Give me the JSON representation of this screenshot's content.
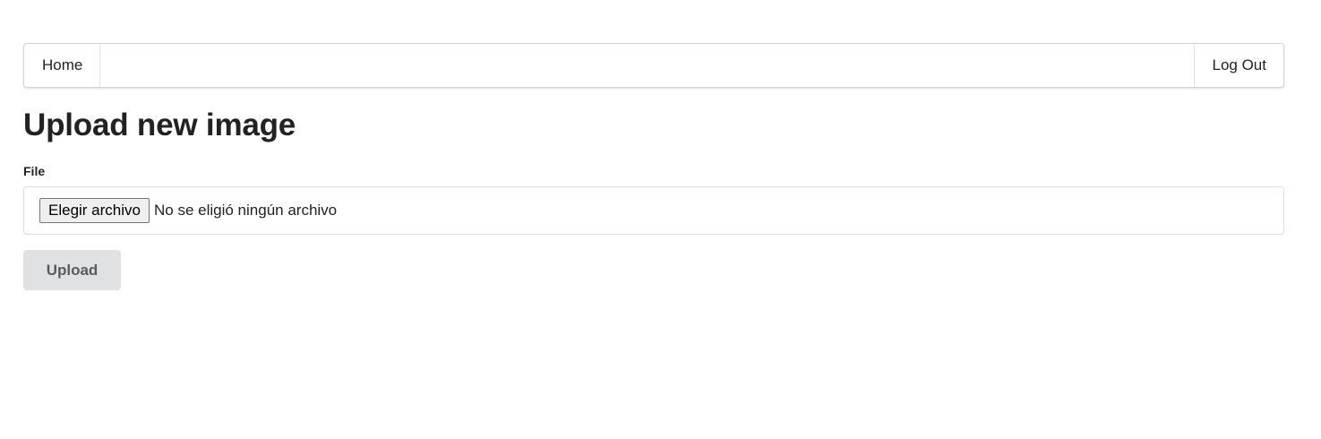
{
  "nav": {
    "home_label": "Home",
    "logout_label": "Log Out"
  },
  "page": {
    "title": "Upload new image"
  },
  "form": {
    "file_label": "File",
    "file_button_label": "Elegir archivo",
    "file_status": "No se eligió ningún archivo",
    "submit_label": "Upload"
  }
}
